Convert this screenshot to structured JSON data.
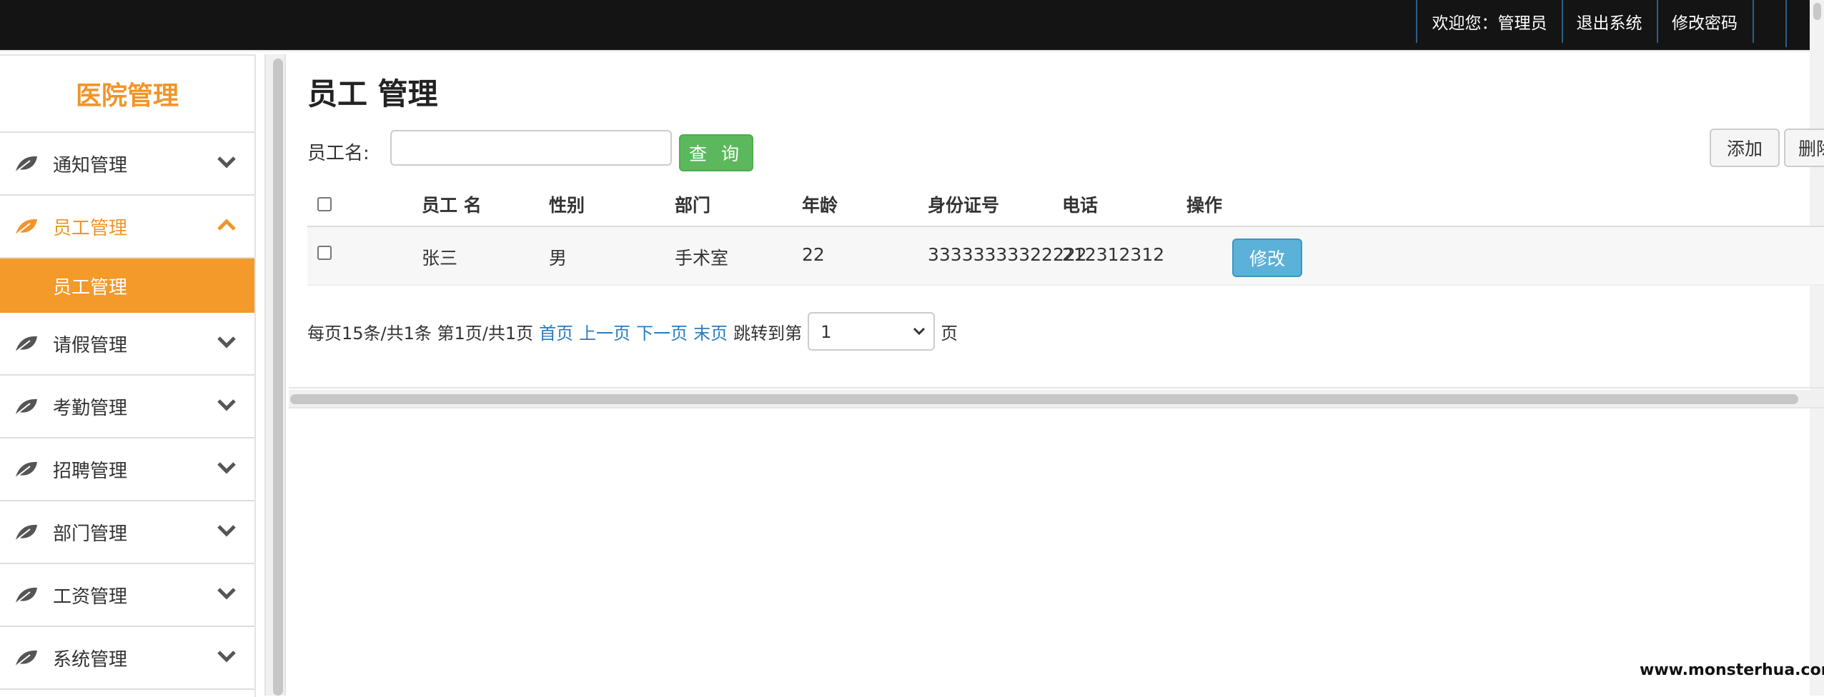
{
  "topbar": {
    "welcome": "欢迎您：管理员",
    "logout": "退出系统",
    "change_password": "修改密码"
  },
  "sidebar": {
    "brand": "医院管理",
    "items": [
      {
        "label": "通知管理",
        "icon": "leaf-icon",
        "state": "collapsed"
      },
      {
        "label": "员工管理",
        "icon": "leaf-icon",
        "state": "expanded"
      },
      {
        "label": "请假管理",
        "icon": "leaf-icon",
        "state": "collapsed"
      },
      {
        "label": "考勤管理",
        "icon": "leaf-icon",
        "state": "collapsed"
      },
      {
        "label": "招聘管理",
        "icon": "leaf-icon",
        "state": "collapsed"
      },
      {
        "label": "部门管理",
        "icon": "leaf-icon",
        "state": "collapsed"
      },
      {
        "label": "工资管理",
        "icon": "leaf-icon",
        "state": "collapsed"
      },
      {
        "label": "系统管理",
        "icon": "leaf-icon",
        "state": "collapsed"
      }
    ],
    "submenu_active": "员工管理"
  },
  "main": {
    "title": "员工 管理",
    "search": {
      "label": "员工名:",
      "value": "",
      "button": "查 询"
    },
    "toolbar": {
      "add": "添加",
      "delete": "删除"
    },
    "table": {
      "columns": [
        "员工 名",
        "性别",
        "部门",
        "年龄",
        "身份证号",
        "电话",
        "操作"
      ],
      "rows": [
        {
          "name": "张三",
          "gender": "男",
          "department": "手术室",
          "age": "22",
          "id_number": "33333333322222",
          "phone": "212312312",
          "action": "修改"
        }
      ]
    },
    "pager": {
      "summary": "每页15条/共1条 第1页/共1页",
      "first": "首页",
      "prev": "上一页",
      "next": "下一页",
      "last": "末页",
      "jump_label": "跳转到第",
      "current_page": "1",
      "page_suffix": "页"
    }
  },
  "watermark": "www.monsterhua.com",
  "colors": {
    "accent": "#f39a2a",
    "topbar": "#141414",
    "search_button": "#5cb85c",
    "edit_button": "#5bb1d8",
    "link": "#2a7bbf"
  }
}
